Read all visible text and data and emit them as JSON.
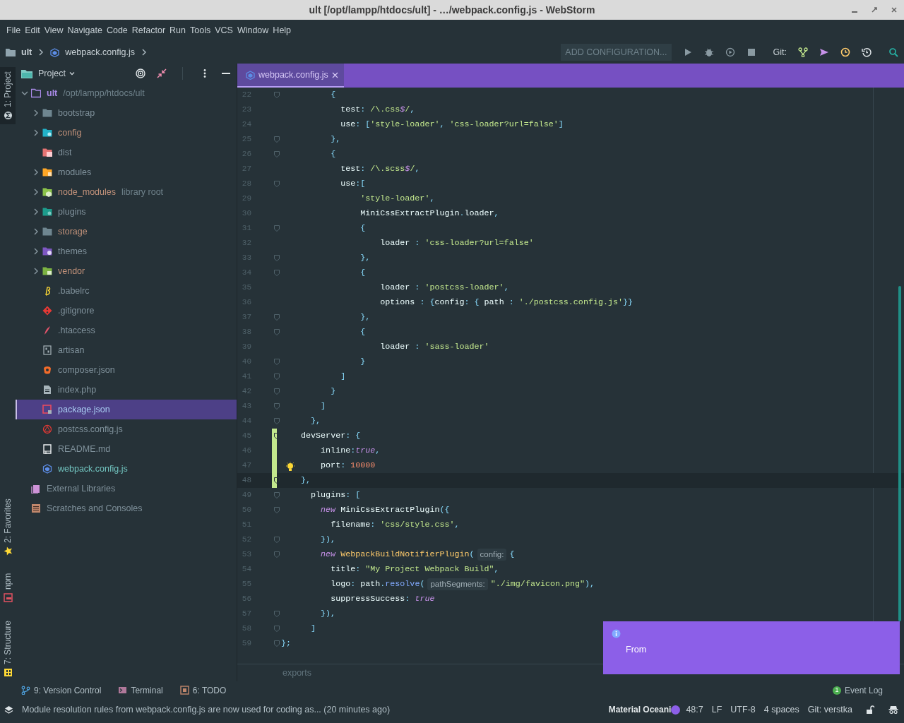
{
  "window": {
    "title": "ult [/opt/lampp/htdocs/ult] - …/webpack.config.js - WebStorm"
  },
  "menu": [
    "File",
    "Edit",
    "View",
    "Navigate",
    "Code",
    "Refactor",
    "Run",
    "Tools",
    "VCS",
    "Window",
    "Help"
  ],
  "nav": {
    "project": "ult",
    "file": "webpack.config.js"
  },
  "toolbar": {
    "config": "ADD CONFIGURATION...",
    "git_label": "Git:"
  },
  "side_tabs": [
    {
      "label": "1: Project",
      "selected": true
    },
    {
      "label": "2: Favorites",
      "selected": false
    },
    {
      "label": "npm",
      "selected": false
    },
    {
      "label": "7: Structure",
      "selected": false
    }
  ],
  "project_panel": {
    "title": "Project",
    "tree": [
      {
        "label": "ult",
        "path": "/opt/lampp/htdocs/ult",
        "kind": "branch",
        "expanded": true,
        "selected": false,
        "color": "#a98ae6",
        "children": [
          {
            "label": "bootstrap",
            "kind": "branch",
            "expanded": false,
            "selected": false,
            "color": "#80929c"
          },
          {
            "label": "config",
            "kind": "branch",
            "expanded": false,
            "selected": false,
            "color": "#c2927a"
          },
          {
            "label": "dist",
            "kind": "leaf",
            "expanded": false,
            "selected": false,
            "color": "#80929c"
          },
          {
            "label": "modules",
            "kind": "branch",
            "expanded": false,
            "selected": false,
            "color": "#80929c"
          },
          {
            "label": "node_modules",
            "note": "library root",
            "kind": "branch",
            "expanded": false,
            "selected": false,
            "color": "#c2927a"
          },
          {
            "label": "plugins",
            "kind": "branch",
            "expanded": false,
            "selected": false,
            "color": "#80929c"
          },
          {
            "label": "storage",
            "kind": "branch",
            "expanded": false,
            "selected": false,
            "color": "#c2927a"
          },
          {
            "label": "themes",
            "kind": "branch",
            "expanded": false,
            "selected": false,
            "color": "#80929c"
          },
          {
            "label": "vendor",
            "kind": "branch",
            "expanded": false,
            "selected": false,
            "color": "#c2927a"
          },
          {
            "label": ".babelrc",
            "kind": "leaf",
            "expanded": false,
            "selected": false,
            "color": "#80929c"
          },
          {
            "label": ".gitignore",
            "kind": "leaf",
            "expanded": false,
            "selected": false,
            "color": "#80929c"
          },
          {
            "label": ".htaccess",
            "kind": "leaf",
            "expanded": false,
            "selected": false,
            "color": "#80929c"
          },
          {
            "label": "artisan",
            "kind": "leaf",
            "expanded": false,
            "selected": false,
            "color": "#80929c"
          },
          {
            "label": "composer.json",
            "kind": "leaf",
            "expanded": false,
            "selected": false,
            "color": "#80929c"
          },
          {
            "label": "index.php",
            "kind": "leaf",
            "expanded": false,
            "selected": false,
            "color": "#80929c"
          },
          {
            "label": "package.json",
            "kind": "leaf",
            "expanded": false,
            "selected": true,
            "color": "#a9cdf2"
          },
          {
            "label": "postcss.config.js",
            "kind": "leaf",
            "expanded": false,
            "selected": false,
            "color": "#80929c"
          },
          {
            "label": "README.md",
            "kind": "leaf",
            "expanded": false,
            "selected": false,
            "color": "#80929c"
          },
          {
            "label": "webpack.config.js",
            "kind": "leaf",
            "expanded": false,
            "selected": false,
            "color": "#72c5c0"
          }
        ]
      },
      {
        "label": "External Libraries",
        "kind": "leaf",
        "expanded": false,
        "selected": false,
        "color": "#80929c"
      },
      {
        "label": "Scratches and Consoles",
        "kind": "leaf",
        "expanded": false,
        "selected": false,
        "color": "#80929c"
      }
    ]
  },
  "editor": {
    "tab": {
      "label": "webpack.config.js",
      "selected": true
    },
    "lines": [
      {
        "n": "22",
        "fold": true,
        "changed": false,
        "current": false,
        "bulb": false,
        "tokens": [
          {
            "text": "          {",
            "kind": "punct"
          }
        ]
      },
      {
        "n": "23",
        "fold": false,
        "changed": false,
        "current": false,
        "bulb": false,
        "tokens": [
          {
            "text": "            test",
            "kind": "ident"
          },
          {
            "text": ": ",
            "kind": "punct"
          },
          {
            "text": "/\\.css",
            "kind": "regex"
          },
          {
            "text": "$",
            "kind": "keyword"
          },
          {
            "text": "/",
            "kind": "regex"
          },
          {
            "text": ",",
            "kind": "punct"
          }
        ]
      },
      {
        "n": "24",
        "fold": false,
        "changed": false,
        "current": false,
        "bulb": false,
        "tokens": [
          {
            "text": "            use",
            "kind": "ident"
          },
          {
            "text": ": [",
            "kind": "punct"
          },
          {
            "text": "'style-loader'",
            "kind": "string"
          },
          {
            "text": ", ",
            "kind": "punct"
          },
          {
            "text": "'css-loader?url=false'",
            "kind": "string"
          },
          {
            "text": "]",
            "kind": "punct"
          }
        ]
      },
      {
        "n": "25",
        "fold": true,
        "changed": false,
        "current": false,
        "bulb": false,
        "tokens": [
          {
            "text": "          },",
            "kind": "punct"
          }
        ]
      },
      {
        "n": "26",
        "fold": true,
        "changed": false,
        "current": false,
        "bulb": false,
        "tokens": [
          {
            "text": "          {",
            "kind": "punct"
          }
        ]
      },
      {
        "n": "27",
        "fold": false,
        "changed": false,
        "current": false,
        "bulb": false,
        "tokens": [
          {
            "text": "            test",
            "kind": "ident"
          },
          {
            "text": ": ",
            "kind": "punct"
          },
          {
            "text": "/\\.scss",
            "kind": "regex"
          },
          {
            "text": "$",
            "kind": "keyword"
          },
          {
            "text": "/",
            "kind": "regex"
          },
          {
            "text": ",",
            "kind": "punct"
          }
        ]
      },
      {
        "n": "28",
        "fold": true,
        "changed": false,
        "current": false,
        "bulb": false,
        "tokens": [
          {
            "text": "            use",
            "kind": "ident"
          },
          {
            "text": ":[",
            "kind": "punct"
          }
        ]
      },
      {
        "n": "29",
        "fold": false,
        "changed": false,
        "current": false,
        "bulb": false,
        "tokens": [
          {
            "text": "                'style-loader'",
            "kind": "string"
          },
          {
            "text": ",",
            "kind": "punct"
          }
        ]
      },
      {
        "n": "30",
        "fold": false,
        "changed": false,
        "current": false,
        "bulb": false,
        "tokens": [
          {
            "text": "                MiniCssExtractPlugin",
            "kind": "ident"
          },
          {
            "text": ".",
            "kind": "punct"
          },
          {
            "text": "loader",
            "kind": "ident"
          },
          {
            "text": ",",
            "kind": "punct"
          }
        ]
      },
      {
        "n": "31",
        "fold": true,
        "changed": false,
        "current": false,
        "bulb": false,
        "tokens": [
          {
            "text": "                {",
            "kind": "punct"
          }
        ]
      },
      {
        "n": "32",
        "fold": false,
        "changed": false,
        "current": false,
        "bulb": false,
        "tokens": [
          {
            "text": "                    loader",
            "kind": "ident"
          },
          {
            "text": " : ",
            "kind": "punct"
          },
          {
            "text": "'css-loader?url=false'",
            "kind": "string"
          }
        ]
      },
      {
        "n": "33",
        "fold": true,
        "changed": false,
        "current": false,
        "bulb": false,
        "tokens": [
          {
            "text": "                },",
            "kind": "punct"
          }
        ]
      },
      {
        "n": "34",
        "fold": true,
        "changed": false,
        "current": false,
        "bulb": false,
        "tokens": [
          {
            "text": "                {",
            "kind": "punct"
          }
        ]
      },
      {
        "n": "35",
        "fold": false,
        "changed": false,
        "current": false,
        "bulb": false,
        "tokens": [
          {
            "text": "                    loader",
            "kind": "ident"
          },
          {
            "text": " : ",
            "kind": "punct"
          },
          {
            "text": "'postcss-loader'",
            "kind": "string"
          },
          {
            "text": ",",
            "kind": "punct"
          }
        ]
      },
      {
        "n": "36",
        "fold": false,
        "changed": false,
        "current": false,
        "bulb": false,
        "tokens": [
          {
            "text": "                    options",
            "kind": "ident"
          },
          {
            "text": " : {",
            "kind": "punct"
          },
          {
            "text": "config",
            "kind": "ident"
          },
          {
            "text": ": { ",
            "kind": "punct"
          },
          {
            "text": "path",
            "kind": "ident"
          },
          {
            "text": " : ",
            "kind": "punct"
          },
          {
            "text": "'./postcss.config.js'",
            "kind": "string"
          },
          {
            "text": "}}",
            "kind": "punct"
          }
        ]
      },
      {
        "n": "37",
        "fold": true,
        "changed": false,
        "current": false,
        "bulb": false,
        "tokens": [
          {
            "text": "                },",
            "kind": "punct"
          }
        ]
      },
      {
        "n": "38",
        "fold": true,
        "changed": false,
        "current": false,
        "bulb": false,
        "tokens": [
          {
            "text": "                {",
            "kind": "punct"
          }
        ]
      },
      {
        "n": "39",
        "fold": false,
        "changed": false,
        "current": false,
        "bulb": false,
        "tokens": [
          {
            "text": "                    loader",
            "kind": "ident"
          },
          {
            "text": " : ",
            "kind": "punct"
          },
          {
            "text": "'sass-loader'",
            "kind": "string"
          }
        ]
      },
      {
        "n": "40",
        "fold": true,
        "changed": false,
        "current": false,
        "bulb": false,
        "tokens": [
          {
            "text": "                }",
            "kind": "punct"
          }
        ]
      },
      {
        "n": "41",
        "fold": true,
        "changed": false,
        "current": false,
        "bulb": false,
        "tokens": [
          {
            "text": "            ]",
            "kind": "punct"
          }
        ]
      },
      {
        "n": "42",
        "fold": true,
        "changed": false,
        "current": false,
        "bulb": false,
        "tokens": [
          {
            "text": "          }",
            "kind": "punct"
          }
        ]
      },
      {
        "n": "43",
        "fold": true,
        "changed": false,
        "current": false,
        "bulb": false,
        "tokens": [
          {
            "text": "        ]",
            "kind": "punct"
          }
        ]
      },
      {
        "n": "44",
        "fold": true,
        "changed": false,
        "current": false,
        "bulb": false,
        "tokens": [
          {
            "text": "      },",
            "kind": "punct"
          }
        ]
      },
      {
        "n": "45",
        "fold": true,
        "changed": true,
        "current": false,
        "bulb": false,
        "tokens": [
          {
            "text": "    devServer",
            "kind": "ident"
          },
          {
            "text": ": {",
            "kind": "punct"
          }
        ]
      },
      {
        "n": "46",
        "fold": false,
        "changed": true,
        "current": false,
        "bulb": false,
        "tokens": [
          {
            "text": "        inline",
            "kind": "ident"
          },
          {
            "text": ":",
            "kind": "punct"
          },
          {
            "text": "true",
            "kind": "keyword"
          },
          {
            "text": ",",
            "kind": "punct"
          }
        ]
      },
      {
        "n": "47",
        "fold": false,
        "changed": true,
        "current": false,
        "bulb": true,
        "tokens": [
          {
            "text": "        port",
            "kind": "ident"
          },
          {
            "text": ": ",
            "kind": "punct"
          },
          {
            "text": "10000",
            "kind": "number"
          }
        ]
      },
      {
        "n": "48",
        "fold": true,
        "changed": true,
        "current": true,
        "bulb": false,
        "tokens": [
          {
            "text": "    },",
            "kind": "punct"
          }
        ]
      },
      {
        "n": "49",
        "fold": true,
        "changed": false,
        "current": false,
        "bulb": false,
        "tokens": [
          {
            "text": "      plugins",
            "kind": "ident"
          },
          {
            "text": ": [",
            "kind": "punct"
          }
        ]
      },
      {
        "n": "50",
        "fold": true,
        "changed": false,
        "current": false,
        "bulb": false,
        "tokens": [
          {
            "text": "        new",
            "kind": "keyword"
          },
          {
            "text": " MiniCssExtractPlugin",
            "kind": "ident"
          },
          {
            "text": "({",
            "kind": "punct"
          }
        ]
      },
      {
        "n": "51",
        "fold": false,
        "changed": false,
        "current": false,
        "bulb": false,
        "tokens": [
          {
            "text": "          filename",
            "kind": "ident"
          },
          {
            "text": ": ",
            "kind": "punct"
          },
          {
            "text": "'css/style.css'",
            "kind": "string"
          },
          {
            "text": ",",
            "kind": "punct"
          }
        ]
      },
      {
        "n": "52",
        "fold": true,
        "changed": false,
        "current": false,
        "bulb": false,
        "tokens": [
          {
            "text": "        }),",
            "kind": "punct"
          }
        ]
      },
      {
        "n": "53",
        "fold": true,
        "changed": false,
        "current": false,
        "bulb": false,
        "tokens": [
          {
            "text": "        new",
            "kind": "keyword"
          },
          {
            "text": " WebpackBuildNotifierPlugin",
            "kind": "class"
          },
          {
            "text": "(",
            "kind": "punct"
          },
          {
            "text": "config:",
            "kind": "hint"
          },
          {
            "text": "{",
            "kind": "punct"
          }
        ]
      },
      {
        "n": "54",
        "fold": false,
        "changed": false,
        "current": false,
        "bulb": false,
        "tokens": [
          {
            "text": "          title",
            "kind": "ident"
          },
          {
            "text": ": ",
            "kind": "punct"
          },
          {
            "text": "\"My Project Webpack Build\"",
            "kind": "string"
          },
          {
            "text": ",",
            "kind": "punct"
          }
        ]
      },
      {
        "n": "55",
        "fold": false,
        "changed": false,
        "current": false,
        "bulb": false,
        "tokens": [
          {
            "text": "          logo",
            "kind": "ident"
          },
          {
            "text": ": ",
            "kind": "punct"
          },
          {
            "text": "path",
            "kind": "ident"
          },
          {
            "text": ".",
            "kind": "punct"
          },
          {
            "text": "resolve",
            "kind": "method"
          },
          {
            "text": "(",
            "kind": "punct"
          },
          {
            "text": "pathSegments:",
            "kind": "hint"
          },
          {
            "text": "\"./img/favicon.png\"",
            "kind": "string"
          },
          {
            "text": "),",
            "kind": "punct"
          }
        ]
      },
      {
        "n": "56",
        "fold": false,
        "changed": false,
        "current": false,
        "bulb": false,
        "tokens": [
          {
            "text": "          suppressSuccess",
            "kind": "ident"
          },
          {
            "text": ": ",
            "kind": "punct"
          },
          {
            "text": "true",
            "kind": "keyword"
          }
        ]
      },
      {
        "n": "57",
        "fold": true,
        "changed": false,
        "current": false,
        "bulb": false,
        "tokens": [
          {
            "text": "        }),",
            "kind": "punct"
          }
        ]
      },
      {
        "n": "58",
        "fold": true,
        "changed": false,
        "current": false,
        "bulb": false,
        "tokens": [
          {
            "text": "      ]",
            "kind": "punct"
          }
        ]
      },
      {
        "n": "59",
        "fold": true,
        "changed": false,
        "current": false,
        "bulb": false,
        "tokens": [
          {
            "text": "};",
            "kind": "punct"
          }
        ]
      }
    ],
    "breadcrumb": "exports"
  },
  "notification": {
    "text": "From"
  },
  "tool_strip": [
    {
      "label": "9: Version Control"
    },
    {
      "label": "Terminal"
    },
    {
      "label": "6: TODO"
    }
  ],
  "event_log": {
    "label": "Event Log",
    "count": "1"
  },
  "status_bar": {
    "message": "Module resolution rules from webpack.config.js are now used for coding as... (20 minutes ago)",
    "theme": "Material Oceani",
    "position": "48:7",
    "line_separator": "LF",
    "encoding": "UTF-8",
    "indent": "4 spaces",
    "git": "Git: verstka"
  }
}
